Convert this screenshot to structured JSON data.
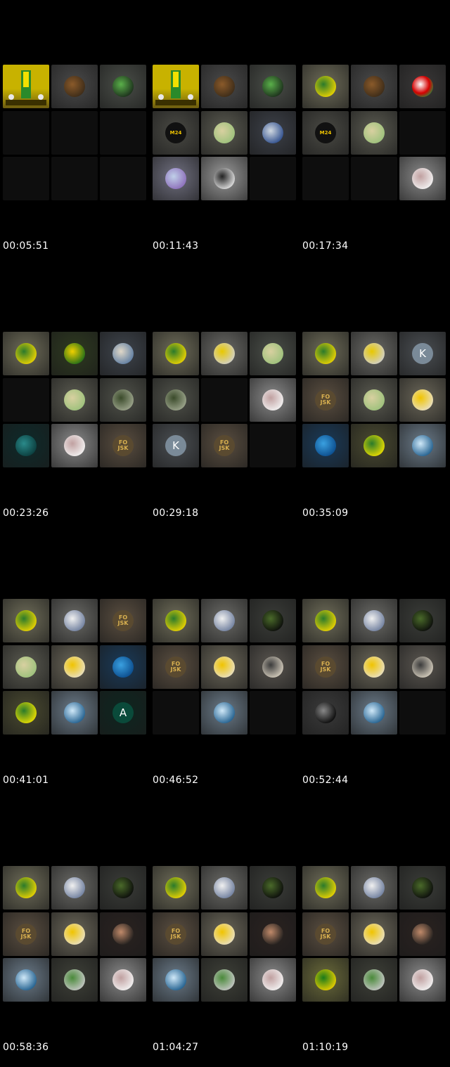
{
  "avatars": {
    "team": {
      "kind": "banner",
      "bg": "#c8b200",
      "fg": "#2a8a2a"
    },
    "lion": {
      "kind": "photo",
      "c1": "#3a2a18",
      "c2": "#8a5a2a"
    },
    "pitch": {
      "kind": "photo",
      "c1": "#1a2a1a",
      "c2": "#5ab04a"
    },
    "jersey": {
      "kind": "photo",
      "c1": "#f2d600",
      "c2": "#2b7a2b"
    },
    "algeria": {
      "kind": "photo",
      "c1": "#2a8a3a",
      "c2": "#ffffff",
      "accent": "#d40000"
    },
    "m24": {
      "kind": "text",
      "label": "M24",
      "c1": "#111111",
      "fg": "#f0c400"
    },
    "crowd": {
      "kind": "photo",
      "c1": "#9ac07a",
      "c2": "#d8d0a0"
    },
    "player": {
      "kind": "photo",
      "c1": "#2a4a8a",
      "c2": "#d0d8e0"
    },
    "alien": {
      "kind": "photo",
      "c1": "#8a6ab8",
      "c2": "#c0d0e8"
    },
    "portrait": {
      "kind": "photo",
      "c1": "#e8e8e8",
      "c2": "#222222"
    },
    "signed": {
      "kind": "photo",
      "c1": "#f4f4f4",
      "c2": "#c0a0a0"
    },
    "flag": {
      "kind": "photo",
      "c1": "#1a6a1a",
      "c2": "#f0d000"
    },
    "fan": {
      "kind": "photo",
      "c1": "#5a7aa0",
      "c2": "#e0d8c8"
    },
    "stadium": {
      "kind": "photo",
      "c1": "#a0a890",
      "c2": "#3a4a2a"
    },
    "logo_n": {
      "kind": "photo",
      "c1": "#0a3a3a",
      "c2": "#2a8a8a"
    },
    "fojsk": {
      "kind": "text",
      "label": "FO\nJSK",
      "c1": "#5a4a30",
      "fg": "#d8b050"
    },
    "half_player": {
      "kind": "photo",
      "c1": "#d0d0d0",
      "c2": "#e8c800"
    },
    "k_letter": {
      "kind": "letter",
      "label": "K",
      "c1": "#7a8a98",
      "fg": "#ffffff"
    },
    "yellow_man": {
      "kind": "photo",
      "c1": "#e8e0c8",
      "c2": "#f0c400"
    },
    "blue_eagle": {
      "kind": "photo",
      "c1": "#0a4a8a",
      "c2": "#3aa0e0"
    },
    "badge": {
      "kind": "photo",
      "c1": "#f0e000",
      "c2": "#2a7a2a"
    },
    "wave": {
      "kind": "photo",
      "c1": "#1a5a8a",
      "c2": "#cfe8f8"
    },
    "a_letter": {
      "kind": "letter",
      "label": "A",
      "c1": "#0a4a3a",
      "fg": "#ffffff"
    },
    "crowd2": {
      "kind": "photo",
      "c1": "#6a7a9a",
      "c2": "#f0f0f0"
    },
    "night": {
      "kind": "photo",
      "c1": "#0a0a0a",
      "c2": "#4a6a2a"
    },
    "statue": {
      "kind": "photo",
      "c1": "#d8d0c0",
      "c2": "#3a3a3a"
    },
    "sign": {
      "kind": "photo",
      "c1": "#050505",
      "c2": "#888888"
    },
    "dark_face": {
      "kind": "photo",
      "c1": "#1a1a1a",
      "c2": "#c08a6a"
    },
    "team_pic": {
      "kind": "photo",
      "c1": "#c8c8c8",
      "c2": "#4a8a3a"
    },
    "stripes": {
      "kind": "photo",
      "c1": "#f0d000",
      "c2": "#1a7a1a"
    }
  },
  "panels": [
    {
      "time": "00:05:51",
      "tiles": [
        {
          "a": "team",
          "bg": "#c8b200"
        },
        {
          "a": "lion",
          "bg": "#4a4a4a"
        },
        {
          "a": "pitch",
          "bg": "#4a4e48"
        },
        {
          "a": null
        },
        {
          "a": null
        },
        {
          "a": null
        },
        {
          "a": null
        },
        {
          "a": null
        },
        {
          "a": null
        }
      ]
    },
    {
      "time": "00:11:43",
      "tiles": [
        {
          "a": "team",
          "bg": "#c8b200"
        },
        {
          "a": "lion",
          "bg": "#4a4a4a"
        },
        {
          "a": "pitch",
          "bg": "#4a4e48"
        },
        {
          "a": "m24",
          "bg": "#4a4a44"
        },
        {
          "a": "crowd",
          "bg": "#5a5a50"
        },
        {
          "a": "player",
          "bg": "#3c4048"
        },
        {
          "a": "alien",
          "bg": "#707080"
        },
        {
          "a": "portrait",
          "bg": "#9a9a9a"
        },
        {
          "a": null
        }
      ]
    },
    {
      "time": "00:17:34",
      "tiles": [
        {
          "a": "jersey",
          "bg": "#6e6c58"
        },
        {
          "a": "lion",
          "bg": "#4a4a4a"
        },
        {
          "a": "algeria",
          "bg": "#3a3838"
        },
        {
          "a": "m24",
          "bg": "#4a4a44"
        },
        {
          "a": "crowd",
          "bg": "#5a5a50"
        },
        {
          "a": null
        },
        {
          "a": null
        },
        {
          "a": null
        },
        {
          "a": "signed",
          "bg": "#8a8a8a"
        }
      ]
    },
    {
      "time": "00:23:26",
      "tiles": [
        {
          "a": "jersey",
          "bg": "#6e6c58"
        },
        {
          "a": "flag",
          "bg": "#2e3a20"
        },
        {
          "a": "fan",
          "bg": "#3e444c"
        },
        {
          "a": null
        },
        {
          "a": "crowd",
          "bg": "#5a5a50"
        },
        {
          "a": "stadium",
          "bg": "#50524a"
        },
        {
          "a": "logo_n",
          "bg": "#0e2a2a"
        },
        {
          "a": "signed",
          "bg": "#8a8a8a"
        },
        {
          "a": "fojsk",
          "bg": "#5a4e40"
        }
      ]
    },
    {
      "time": "00:29:18",
      "tiles": [
        {
          "a": "jersey",
          "bg": "#6e6c58"
        },
        {
          "a": "half_player",
          "bg": "#6a6a66"
        },
        {
          "a": "crowd",
          "bg": "#4a4e48"
        },
        {
          "a": "stadium",
          "bg": "#50524a"
        },
        {
          "a": null
        },
        {
          "a": "signed",
          "bg": "#8a8a8a"
        },
        {
          "a": "k_letter",
          "bg": "#4a4e52"
        },
        {
          "a": "fojsk",
          "bg": "#5a4e40"
        },
        {
          "a": null
        }
      ]
    },
    {
      "time": "00:35:09",
      "tiles": [
        {
          "a": "jersey",
          "bg": "#6e6c58"
        },
        {
          "a": "half_player",
          "bg": "#6a6a66"
        },
        {
          "a": "k_letter",
          "bg": "#4a4e52"
        },
        {
          "a": "fojsk",
          "bg": "#5a4e40"
        },
        {
          "a": "crowd",
          "bg": "#5a5a50"
        },
        {
          "a": "yellow_man",
          "bg": "#6a6658"
        },
        {
          "a": "blue_eagle",
          "bg": "#1a3a58"
        },
        {
          "a": "badge",
          "bg": "#4a4a30"
        },
        {
          "a": "wave",
          "bg": "#6a7a88"
        }
      ]
    },
    {
      "time": "00:41:01",
      "tiles": [
        {
          "a": "jersey",
          "bg": "#6e6c58"
        },
        {
          "a": "crowd2",
          "bg": "#6a6a66"
        },
        {
          "a": "fojsk",
          "bg": "#5a4e40"
        },
        {
          "a": "crowd",
          "bg": "#5a5a50"
        },
        {
          "a": "yellow_man",
          "bg": "#6a6658"
        },
        {
          "a": "blue_eagle",
          "bg": "#1a3a58"
        },
        {
          "a": "badge",
          "bg": "#4a4a30"
        },
        {
          "a": "wave",
          "bg": "#6a7a88"
        },
        {
          "a": "a_letter",
          "bg": "#0e2620"
        }
      ]
    },
    {
      "time": "00:46:52",
      "tiles": [
        {
          "a": "jersey",
          "bg": "#6e6c58"
        },
        {
          "a": "crowd2",
          "bg": "#6a6a66"
        },
        {
          "a": "night",
          "bg": "#3a3c38"
        },
        {
          "a": "fojsk",
          "bg": "#5a4e40"
        },
        {
          "a": "yellow_man",
          "bg": "#6a6658"
        },
        {
          "a": "statue",
          "bg": "#5a5650"
        },
        {
          "a": null
        },
        {
          "a": "wave",
          "bg": "#6a7a88"
        },
        {
          "a": null
        }
      ]
    },
    {
      "time": "00:52:44",
      "tiles": [
        {
          "a": "jersey",
          "bg": "#6e6c58"
        },
        {
          "a": "crowd2",
          "bg": "#6a6a66"
        },
        {
          "a": "night",
          "bg": "#3a3c38"
        },
        {
          "a": "fojsk",
          "bg": "#5a4e40"
        },
        {
          "a": "yellow_man",
          "bg": "#6a6658"
        },
        {
          "a": "statue",
          "bg": "#5a5650"
        },
        {
          "a": "sign",
          "bg": "#3a3a3a"
        },
        {
          "a": "wave",
          "bg": "#6a7a88"
        },
        {
          "a": null
        }
      ]
    },
    {
      "time": "00:58:36",
      "tiles": [
        {
          "a": "jersey",
          "bg": "#6e6c58"
        },
        {
          "a": "crowd2",
          "bg": "#6a6a66"
        },
        {
          "a": "night",
          "bg": "#3a3c38"
        },
        {
          "a": "fojsk",
          "bg": "#5a4e40"
        },
        {
          "a": "yellow_man",
          "bg": "#6a6658"
        },
        {
          "a": "dark_face",
          "bg": "#2a2220"
        },
        {
          "a": "wave",
          "bg": "#6a7a88"
        },
        {
          "a": "team_pic",
          "bg": "#3e4038"
        },
        {
          "a": "signed",
          "bg": "#8a8a8a"
        }
      ]
    },
    {
      "time": "01:04:27",
      "tiles": [
        {
          "a": "jersey",
          "bg": "#6e6c58"
        },
        {
          "a": "crowd2",
          "bg": "#6a6a66"
        },
        {
          "a": "night",
          "bg": "#3a3c38"
        },
        {
          "a": "fojsk",
          "bg": "#5a4e40"
        },
        {
          "a": "yellow_man",
          "bg": "#6a6658"
        },
        {
          "a": "dark_face",
          "bg": "#2a2220"
        },
        {
          "a": "wave",
          "bg": "#6a7a88"
        },
        {
          "a": "team_pic",
          "bg": "#3e4038"
        },
        {
          "a": "signed",
          "bg": "#8a8a8a"
        }
      ]
    },
    {
      "time": "01:10:19",
      "tiles": [
        {
          "a": "jersey",
          "bg": "#6e6c58"
        },
        {
          "a": "crowd2",
          "bg": "#6a6a66"
        },
        {
          "a": "night",
          "bg": "#3a3c38"
        },
        {
          "a": "fojsk",
          "bg": "#5a4e40"
        },
        {
          "a": "yellow_man",
          "bg": "#6a6658"
        },
        {
          "a": "dark_face",
          "bg": "#2a2220"
        },
        {
          "a": "stripes",
          "bg": "#6a6a3a"
        },
        {
          "a": "team_pic",
          "bg": "#3e4038"
        },
        {
          "a": "signed",
          "bg": "#8a8a8a"
        }
      ]
    }
  ]
}
